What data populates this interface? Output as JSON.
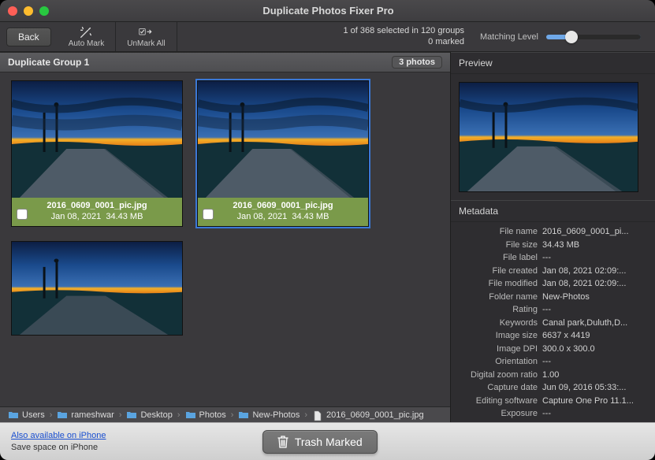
{
  "colors": {
    "traffic_close": "#ff5f57",
    "traffic_min": "#febc2e",
    "traffic_max": "#28c840"
  },
  "title": "Duplicate Photos Fixer Pro",
  "toolbar": {
    "back": "Back",
    "automark": "Auto Mark",
    "unmarkall": "UnMark All"
  },
  "stats": {
    "selection": "1 of 368 selected in 120 groups",
    "marked": "0 marked"
  },
  "matching": {
    "label": "Matching Level"
  },
  "group": {
    "title": "Duplicate Group 1",
    "count": "3 photos"
  },
  "cards": [
    {
      "filename": "2016_0609_0001_pic.jpg",
      "date": "Jan 08, 2021",
      "size": "34.43 MB"
    },
    {
      "filename": "2016_0609_0001_pic.jpg",
      "date": "Jan 08, 2021",
      "size": "34.43 MB"
    }
  ],
  "side": {
    "preview": "Preview",
    "metadata": "Metadata",
    "rows": [
      {
        "k": "File name",
        "v": "2016_0609_0001_pi..."
      },
      {
        "k": "File size",
        "v": "34.43 MB"
      },
      {
        "k": "File label",
        "v": "---"
      },
      {
        "k": "File created",
        "v": "Jan 08, 2021 02:09:..."
      },
      {
        "k": "File modified",
        "v": "Jan 08, 2021 02:09:..."
      },
      {
        "k": "Folder name",
        "v": "New-Photos"
      },
      {
        "k": "Rating",
        "v": "---"
      },
      {
        "k": "Keywords",
        "v": "Canal park,Duluth,D..."
      },
      {
        "k": "Image size",
        "v": "6637 x 4419"
      },
      {
        "k": "Image DPI",
        "v": "300.0 x 300.0"
      },
      {
        "k": "Orientation",
        "v": "---"
      },
      {
        "k": "Digital zoom ratio",
        "v": "1.00"
      },
      {
        "k": "Capture date",
        "v": "Jun 09, 2016 05:33:..."
      },
      {
        "k": "Editing software",
        "v": "Capture One Pro 11.1..."
      },
      {
        "k": "Exposure",
        "v": "---"
      }
    ]
  },
  "path": [
    "Users",
    "rameshwar",
    "Desktop",
    "Photos",
    "New-Photos",
    "2016_0609_0001_pic.jpg"
  ],
  "footer": {
    "link": "Also available on iPhone",
    "sub": "Save space on iPhone",
    "trash": "Trash Marked"
  }
}
